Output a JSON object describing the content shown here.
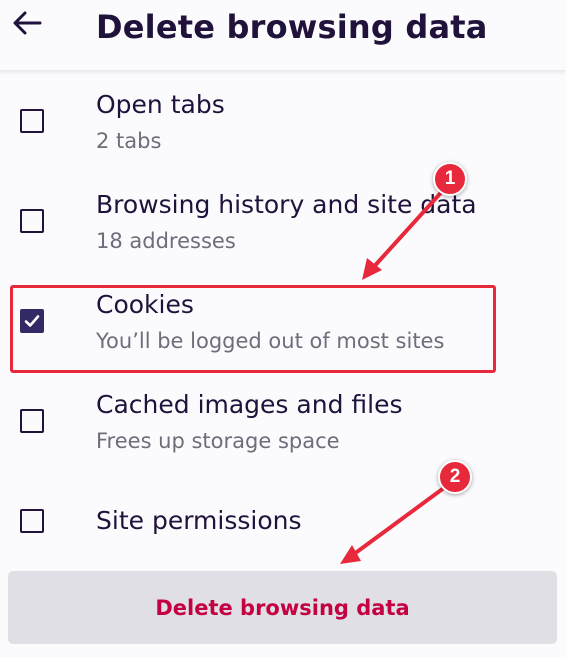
{
  "header": {
    "title": "Delete browsing data",
    "back_icon": "arrow-left-icon"
  },
  "options": [
    {
      "title": "Open tabs",
      "subtitle": "2 tabs",
      "checked": false
    },
    {
      "title": "Browsing history and site data",
      "subtitle": "18 addresses",
      "checked": false
    },
    {
      "title": "Cookies",
      "subtitle": "You’ll be logged out of most sites",
      "checked": true
    },
    {
      "title": "Cached images and files",
      "subtitle": "Frees up storage space",
      "checked": false
    },
    {
      "title": "Site permissions",
      "checked": false
    }
  ],
  "action": {
    "delete_label": "Delete browsing data"
  },
  "annotations": {
    "badge_1": "1",
    "badge_2": "2",
    "color": "#e8293b"
  },
  "colors": {
    "accent": "#312a65",
    "text": "#20123a",
    "subtext": "#6e6d7a",
    "destructive": "#c50042",
    "button_bg": "#e0dfe5"
  }
}
